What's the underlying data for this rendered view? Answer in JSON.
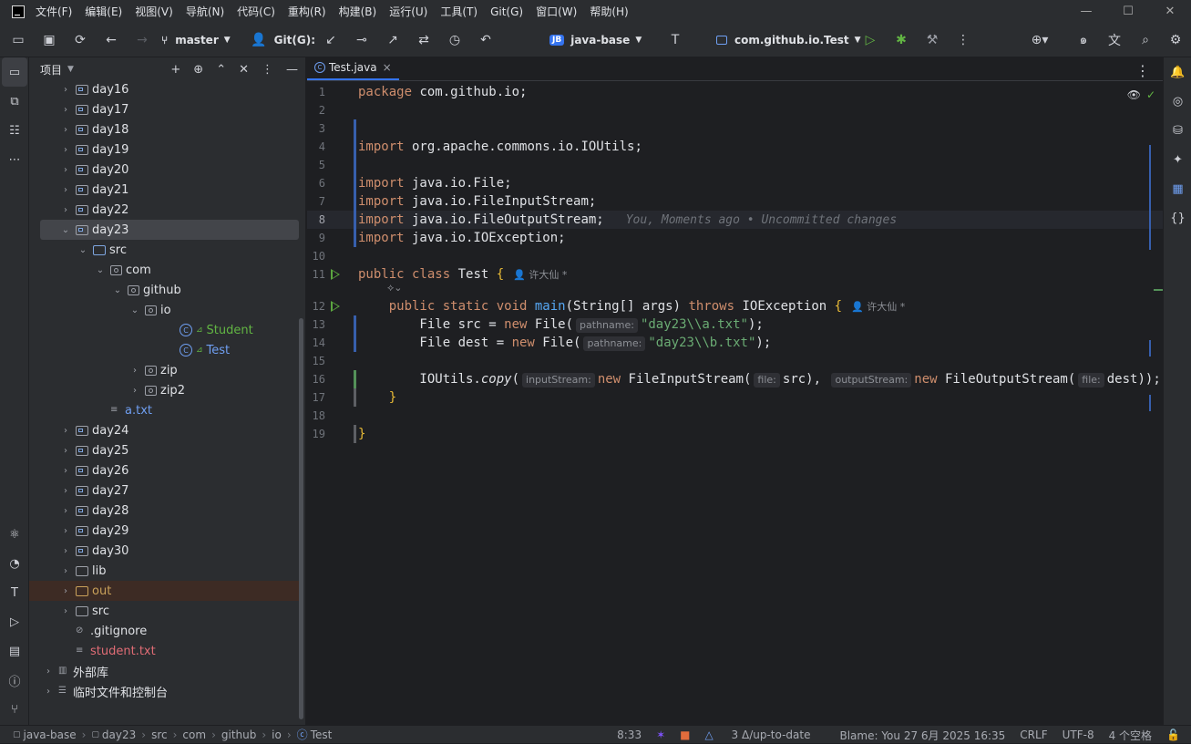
{
  "menu": [
    "文件(F)",
    "编辑(E)",
    "视图(V)",
    "导航(N)",
    "代码(C)",
    "重构(R)",
    "构建(B)",
    "运行(U)",
    "工具(T)",
    "Git(G)",
    "窗口(W)",
    "帮助(H)"
  ],
  "toolbar": {
    "branch": "master",
    "git_label": "Git(G):",
    "project_badge": "JB",
    "project_name": "java-base",
    "run_config": "com.github.io.Test"
  },
  "project_panel": {
    "title": "项目",
    "tree": [
      {
        "label": "day16",
        "depth": 1,
        "kind": "module",
        "expanded": false
      },
      {
        "label": "day17",
        "depth": 1,
        "kind": "module",
        "expanded": false
      },
      {
        "label": "day18",
        "depth": 1,
        "kind": "module",
        "expanded": false
      },
      {
        "label": "day19",
        "depth": 1,
        "kind": "module",
        "expanded": false
      },
      {
        "label": "day20",
        "depth": 1,
        "kind": "module",
        "expanded": false
      },
      {
        "label": "day21",
        "depth": 1,
        "kind": "module",
        "expanded": false
      },
      {
        "label": "day22",
        "depth": 1,
        "kind": "module",
        "expanded": false
      },
      {
        "label": "day23",
        "depth": 1,
        "kind": "module",
        "expanded": true,
        "selected": true
      },
      {
        "label": "src",
        "depth": 2,
        "kind": "src",
        "expanded": true
      },
      {
        "label": "com",
        "depth": 3,
        "kind": "package",
        "expanded": true
      },
      {
        "label": "github",
        "depth": 4,
        "kind": "package",
        "expanded": true
      },
      {
        "label": "io",
        "depth": 5,
        "kind": "package",
        "expanded": true
      },
      {
        "label": "Student",
        "depth": 7,
        "kind": "class",
        "color": "green"
      },
      {
        "label": "Test",
        "depth": 7,
        "kind": "class",
        "color": "blue"
      },
      {
        "label": "zip",
        "depth": 5,
        "kind": "package",
        "expanded": false
      },
      {
        "label": "zip2",
        "depth": 5,
        "kind": "package",
        "expanded": false
      },
      {
        "label": "a.txt",
        "depth": 3,
        "kind": "file",
        "color": "blue"
      },
      {
        "label": "day24",
        "depth": 1,
        "kind": "module",
        "expanded": false
      },
      {
        "label": "day25",
        "depth": 1,
        "kind": "module",
        "expanded": false
      },
      {
        "label": "day26",
        "depth": 1,
        "kind": "module",
        "expanded": false
      },
      {
        "label": "day27",
        "depth": 1,
        "kind": "module",
        "expanded": false
      },
      {
        "label": "day28",
        "depth": 1,
        "kind": "module",
        "expanded": false
      },
      {
        "label": "day29",
        "depth": 1,
        "kind": "module",
        "expanded": false
      },
      {
        "label": "day30",
        "depth": 1,
        "kind": "module",
        "expanded": false
      },
      {
        "label": "lib",
        "depth": 1,
        "kind": "folder",
        "expanded": false
      },
      {
        "label": "out",
        "depth": 1,
        "kind": "out",
        "expanded": false,
        "color": "orange"
      },
      {
        "label": "src",
        "depth": 1,
        "kind": "folder",
        "expanded": false
      },
      {
        "label": ".gitignore",
        "depth": 1,
        "kind": "ignore"
      },
      {
        "label": "student.txt",
        "depth": 1,
        "kind": "file",
        "color": "red"
      },
      {
        "label": "外部库",
        "depth": 0,
        "kind": "lib",
        "expanded": false
      },
      {
        "label": "临时文件和控制台",
        "depth": 0,
        "kind": "scratch",
        "expanded": false
      }
    ]
  },
  "editor": {
    "tab": "Test.java",
    "lines": [
      {
        "n": "1",
        "html": "<span class='kw'>package</span> com.github.io;"
      },
      {
        "n": "2",
        "html": ""
      },
      {
        "n": "3",
        "html": ""
      },
      {
        "n": "4",
        "html": "<span class='kw'>import</span> org.apache.commons.io.IOUtils;"
      },
      {
        "n": "5",
        "html": ""
      },
      {
        "n": "6",
        "html": "<span class='kw'>import</span> java.io.File;"
      },
      {
        "n": "7",
        "html": "<span class='kw'>import</span> java.io.FileInputStream;"
      },
      {
        "n": "8",
        "html": "<span class='kw'>import</span> java.io.FileOutputStream;"
      },
      {
        "n": "9",
        "html": "<span class='kw'>import</span> java.io.IOException;"
      },
      {
        "n": "10",
        "html": ""
      },
      {
        "n": "11",
        "html": "<span class='kw'>public class</span> Test <span class='brace'>{</span>"
      },
      {
        "n": "12",
        "html": "    <span class='kw'>public static void</span> <span class='fn'>main</span>(String[] args) <span class='kw'>throws</span> IOException <span class='brace'>{</span>"
      },
      {
        "n": "13",
        "html": "        File src = <span class='kw'>new</span> File(<span class='hint'>pathname:</span><span class='st'>\"day23\\\\a.txt\"</span>);"
      },
      {
        "n": "14",
        "html": "        File dest = <span class='kw'>new</span> File(<span class='hint'>pathname:</span><span class='st'>\"day23\\\\b.txt\"</span>);"
      },
      {
        "n": "15",
        "html": ""
      },
      {
        "n": "16",
        "html": "        IOUtils.<span class='it'>copy</span>(<span class='hint'>inputStream:</span><span class='kw'>new</span> FileInputStream(<span class='hint'>file:</span>src), <span class='hint'>outputStream:</span><span class='kw'>new</span> FileOutputStream(<span class='hint'>file:</span>dest));"
      },
      {
        "n": "17",
        "html": "    <span class='brace'>}</span>"
      },
      {
        "n": "18",
        "html": ""
      },
      {
        "n": "19",
        "html": "<span class='brace'>}</span>"
      }
    ],
    "blame_line8": "You, Moments ago • Uncommitted changes",
    "author": "许大仙 *"
  },
  "status": {
    "crumbs": [
      "java-base",
      "day23",
      "src",
      "com",
      "github",
      "io",
      "Test"
    ],
    "position": "8:33",
    "vcs": "3 Δ/up-to-date",
    "blame": "Blame: You 27 6月 2025 16:35",
    "line_sep": "CRLF",
    "encoding": "UTF-8",
    "indent": "4 个空格"
  }
}
